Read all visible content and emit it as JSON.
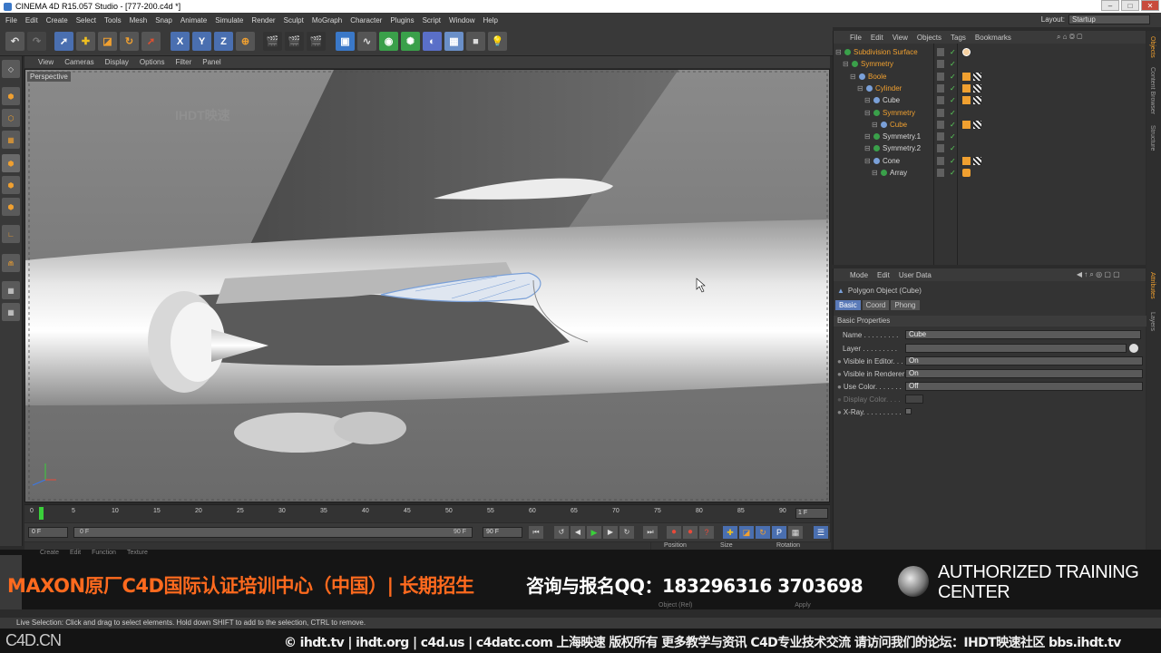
{
  "window": {
    "title": "CINEMA 4D R15.057 Studio - [777-200.c4d *]"
  },
  "menubar": {
    "items": [
      "File",
      "Edit",
      "Create",
      "Select",
      "Tools",
      "Mesh",
      "Snap",
      "Animate",
      "Simulate",
      "Render",
      "Sculpt",
      "MoGraph",
      "Character",
      "Plugins",
      "Script",
      "Window",
      "Help"
    ],
    "layout_label": "Layout:",
    "layout_value": "Startup"
  },
  "viewport": {
    "menu": [
      "View",
      "Cameras",
      "Display",
      "Options",
      "Filter",
      "Panel"
    ],
    "label": "Perspective",
    "watermark": "IHDT映速"
  },
  "timeline": {
    "ticks": [
      "0",
      "5",
      "10",
      "15",
      "20",
      "25",
      "30",
      "35",
      "40",
      "45",
      "50",
      "55",
      "60",
      "65",
      "70",
      "75",
      "80",
      "85",
      "90"
    ],
    "current_frame": "1 F",
    "start": "0 F",
    "range_start": "0 F",
    "range_end": "90 F",
    "end": "90 F"
  },
  "object_manager": {
    "menu": [
      "File",
      "Edit",
      "View",
      "Objects",
      "Tags",
      "Bookmarks"
    ],
    "objects": [
      {
        "name": "Subdivision Surface",
        "color": "#f0a030"
      },
      {
        "name": "Symmetry",
        "color": "#f0a030"
      },
      {
        "name": "Boole",
        "color": "#f0a030"
      },
      {
        "name": "Cylinder",
        "color": "#f0a030"
      },
      {
        "name": "Cube",
        "color": "#d8d8d8"
      },
      {
        "name": "Symmetry",
        "color": "#f0a030"
      },
      {
        "name": "Cube",
        "color": "#f0a030"
      },
      {
        "name": "Symmetry.1",
        "color": "#d8d8d8"
      },
      {
        "name": "Symmetry.2",
        "color": "#d8d8d8"
      },
      {
        "name": "Cone",
        "color": "#d8d8d8"
      },
      {
        "name": "Array",
        "color": "#d8d8d8"
      }
    ]
  },
  "attribute_manager": {
    "menu": [
      "Mode",
      "Edit",
      "User Data"
    ],
    "object_title": "Polygon Object (Cube)",
    "tabs": [
      "Basic",
      "Coord",
      "Phong"
    ],
    "section": "Basic Properties",
    "fields": {
      "name_label": "Name . . . . . . . . .",
      "name_value": "Cube",
      "layer_label": "Layer . . . . . . . . .",
      "visible_editor_label": "Visible in Editor. . .",
      "visible_editor_value": "On",
      "visible_renderer_label": "Visible in Renderer",
      "visible_renderer_value": "On",
      "use_color_label": "Use Color. . . . . . .",
      "use_color_value": "Off",
      "display_color_label": "Display Color. . . .",
      "xray_label": "X-Ray. . . . . . . . . ."
    }
  },
  "side_tabs": [
    "Objects",
    "Content Browser",
    "Structure",
    "Attributes",
    "Layers"
  ],
  "coord_panel": {
    "headers": [
      "Position",
      "Size",
      "Rotation"
    ],
    "apply": "Apply",
    "mode": "Object (Rel)"
  },
  "material_panel": {
    "menu": [
      "Create",
      "Edit",
      "Function",
      "Texture"
    ]
  },
  "banner": {
    "promo": "MAXON原厂C4D国际认证培训中心（中国）| 长期招生",
    "qq": "咨询与报名QQ：183296316   3703698",
    "atc_line1": "AUTHORIZED TRAINING",
    "atc_line2": "CENTER"
  },
  "status": {
    "text": "Live Selection: Click and drag to select elements. Hold down SHIFT to add to the selection, CTRL to remove."
  },
  "footer": {
    "logo": "C4D.CN",
    "copyright": "© ihdt.tv | ihdt.org | c4d.us | c4datc.com 上海映速 版权所有 更多教学与资讯 C4D专业技术交流 请访问我们的论坛：IHDT映速社区 bbs.ihdt.tv"
  },
  "colors": {
    "accent": "#f0a030",
    "selected_tab": "#5a7ab8",
    "promo": "#ff6a1e",
    "check": "#5bd25b"
  }
}
